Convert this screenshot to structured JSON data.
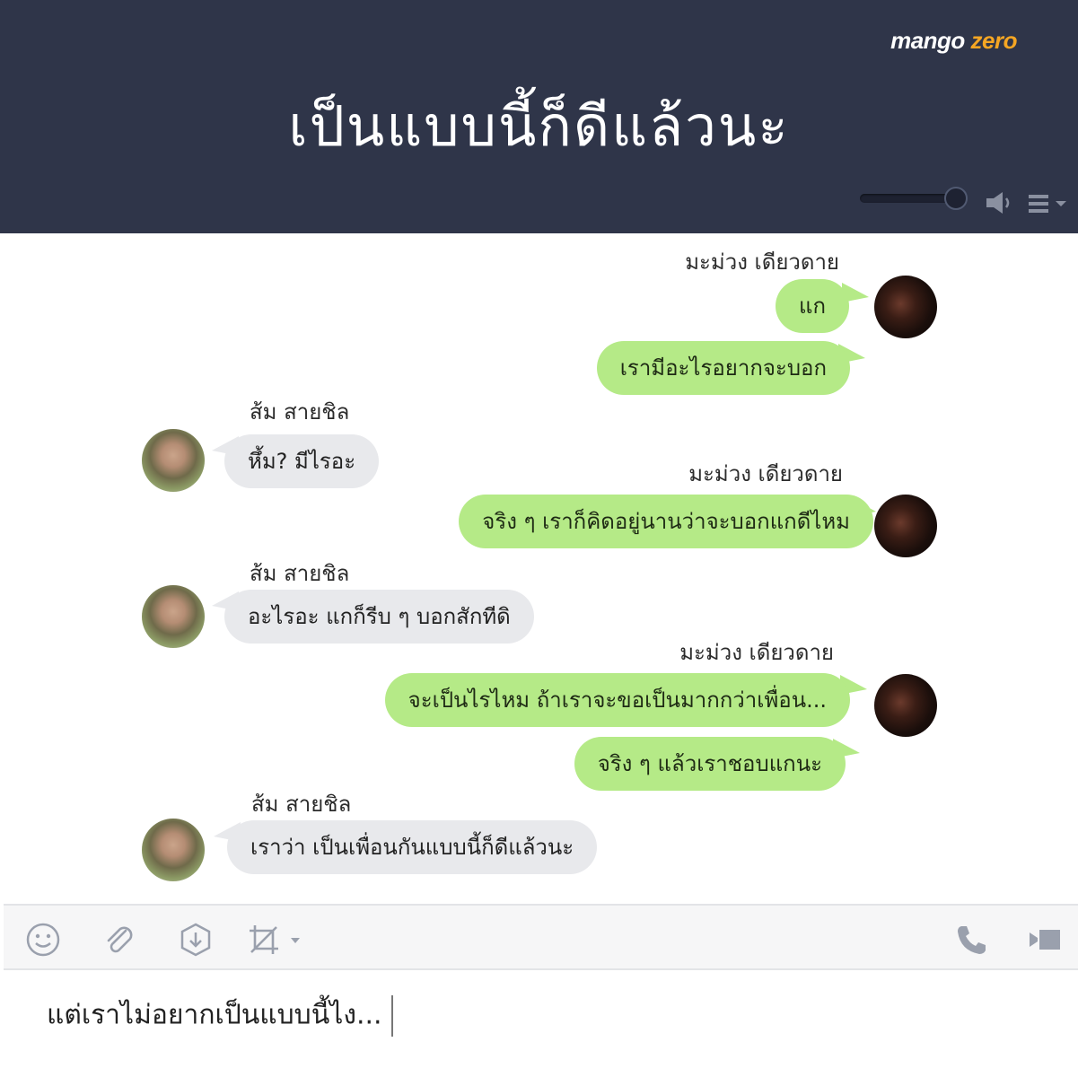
{
  "header": {
    "brand_main": "mango ",
    "brand_accent": "zero",
    "title": "เป็นแบบนี้ก็ดีแล้วนะ"
  },
  "messages": {
    "me_name": "มะม่วง เดียวดาย",
    "them_name": "ส้ม สายชิล",
    "m1": "แก",
    "m2": "เรามีอะไรอยากจะบอก",
    "t1": "หึ้ม? มีไรอะ",
    "m3": "จริง ๆ เราก็คิดอยู่นานว่าจะบอกแกดีไหม",
    "t2": "อะไรอะ แกก็รีบ ๆ บอกสักทีดิ",
    "m4": "จะเป็นไรไหม ถ้าเราจะขอเป็นมากกว่าเพื่อน...",
    "m5": "จริง ๆ แล้วเราชอบแกนะ",
    "t3": "เราว่า เป็นเพื่อนกันแบบนี้ก็ดีแล้วนะ"
  },
  "composer": {
    "text": "แต่เราไม่อยากเป็นแบบนี้ไง..."
  },
  "colors": {
    "header_bg": "#2f3549",
    "my_bubble": "#b5ea87",
    "their_bubble": "#e8e9ec",
    "brand_accent": "#f5a623"
  },
  "icons": [
    "volume-slider",
    "speaker-icon",
    "menu-icon",
    "emoji-icon",
    "paperclip-icon",
    "download-icon",
    "crop-icon",
    "phone-icon",
    "video-icon"
  ]
}
